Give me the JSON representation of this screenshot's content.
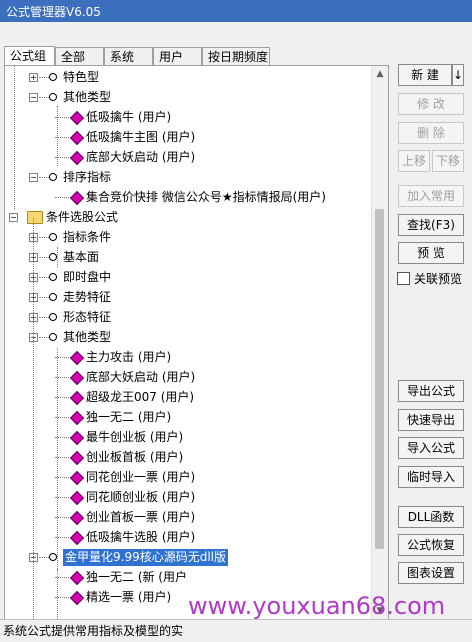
{
  "window": {
    "title": "公式管理器V6.05"
  },
  "tabs": [
    {
      "label": "公式组",
      "active": true
    },
    {
      "label": "全部",
      "active": false
    },
    {
      "label": "系统",
      "active": false
    },
    {
      "label": "用户",
      "active": false
    },
    {
      "label": "按日期频度",
      "active": false
    }
  ],
  "tree": [
    {
      "label": "特色型",
      "kind": "group",
      "depth": 1
    },
    {
      "label": "其他类型",
      "kind": "group",
      "depth": 1,
      "expanded": true
    },
    {
      "label": "低吸擒牛 (用户)",
      "kind": "formula",
      "depth": 2
    },
    {
      "label": "低吸擒牛主图 (用户)",
      "kind": "formula",
      "depth": 2
    },
    {
      "label": "底部大妖启动 (用户)",
      "kind": "formula",
      "depth": 2
    },
    {
      "label": "排序指标",
      "kind": "group",
      "depth": 1,
      "expanded": true
    },
    {
      "label": "集合竞价快排 微信公众号★指标情报局(用户)",
      "kind": "formula",
      "depth": 2
    },
    {
      "label": "条件选股公式",
      "kind": "folder",
      "depth": 0
    },
    {
      "label": "指标条件",
      "kind": "group",
      "depth": 1
    },
    {
      "label": "基本面",
      "kind": "group",
      "depth": 1
    },
    {
      "label": "即时盘中",
      "kind": "group",
      "depth": 1
    },
    {
      "label": "走势特征",
      "kind": "group",
      "depth": 1
    },
    {
      "label": "形态特征",
      "kind": "group",
      "depth": 1
    },
    {
      "label": "其他类型",
      "kind": "group",
      "depth": 1,
      "expanded": true
    },
    {
      "label": "主力攻击 (用户)",
      "kind": "formula",
      "depth": 2
    },
    {
      "label": "底部大妖启动 (用户)",
      "kind": "formula",
      "depth": 2
    },
    {
      "label": "超级龙王007 (用户)",
      "kind": "formula",
      "depth": 2
    },
    {
      "label": "独一无二 (用户)",
      "kind": "formula",
      "depth": 2
    },
    {
      "label": "最牛创业板 (用户)",
      "kind": "formula",
      "depth": 2
    },
    {
      "label": "创业板首板 (用户)",
      "kind": "formula",
      "depth": 2
    },
    {
      "label": "同花创业一票 (用户)",
      "kind": "formula",
      "depth": 2
    },
    {
      "label": "同花顺创业板 (用户)",
      "kind": "formula",
      "depth": 2
    },
    {
      "label": "创业首板一票 (用户)",
      "kind": "formula",
      "depth": 2
    },
    {
      "label": "低吸擒牛选股 (用户)",
      "kind": "formula",
      "depth": 2
    },
    {
      "label": "金甲量化9.99核心源码无dll版",
      "kind": "group",
      "depth": 1,
      "expanded": true,
      "selected": true
    },
    {
      "label": "独一无二 (新 (用户",
      "kind": "formula",
      "depth": 2
    },
    {
      "label": "精选一票 (用户)",
      "kind": "formula",
      "depth": 2
    }
  ],
  "buttons": {
    "new": "新 建",
    "new_arrow": "↓",
    "modify": "修 改",
    "delete": "删 除",
    "move_up": "上移",
    "move_down": "下移",
    "add_common": "加入常用",
    "find": "查找(F3)",
    "preview": "预 览",
    "link_preview": "关联预览",
    "export": "导出公式",
    "quick_export": "快速导出",
    "import": "导入公式",
    "temp_import": "临时导入",
    "dll": "DLL函数",
    "restore": "公式恢复",
    "extra": "图表设置"
  },
  "status": {
    "text": "系统公式提供常用指标及模型的实"
  },
  "watermark": {
    "text": "www.youxuan68.com"
  },
  "colors": {
    "titlebar": "#3c6fbe",
    "selection": "#2f72d2",
    "formula_icon": "#d400b0",
    "watermark": "#b03ac8"
  }
}
